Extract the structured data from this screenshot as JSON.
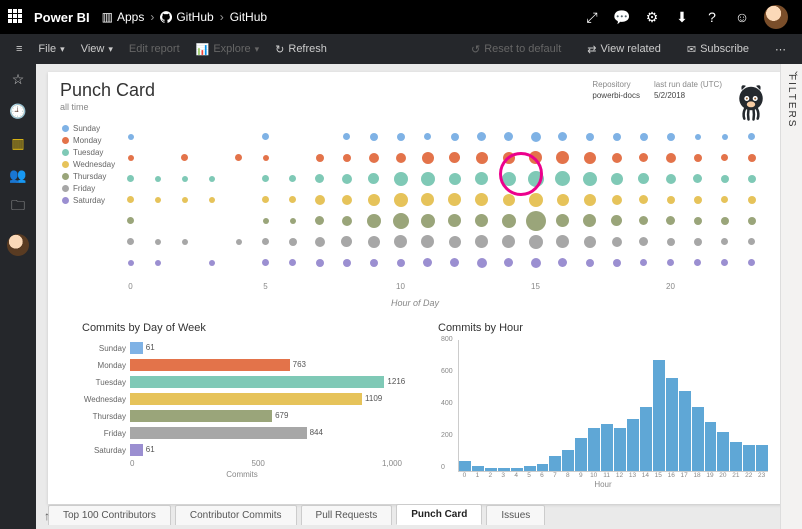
{
  "brand": "Power BI",
  "breadcrumb": {
    "apps_icon": "Apps",
    "gh_icon": "GitHub",
    "gh_page": "GitHub"
  },
  "menubar": {
    "file": "File",
    "view": "View",
    "edit": "Edit report",
    "explore": "Explore",
    "refresh": "Refresh",
    "reset": "Reset to default",
    "view_related": "View related",
    "subscribe": "Subscribe"
  },
  "filters_label": "FILTERS",
  "report": {
    "title": "Punch Card",
    "subtitle": "all time",
    "meta": {
      "repo_label": "Repository",
      "repo_value": "powerbi-docs",
      "run_label": "last run date (UTC)",
      "run_value": "5/2/2018"
    }
  },
  "days": [
    "Sunday",
    "Monday",
    "Tuesday",
    "Wednesday",
    "Thursday",
    "Friday",
    "Saturday"
  ],
  "day_colors": [
    "#7fb2e5",
    "#e3734a",
    "#7fc9b6",
    "#e6c35a",
    "#9aa57a",
    "#a7a7a7",
    "#9b8fd1"
  ],
  "punch_axis_label": "Hour of Day",
  "dow_title": "Commits by Day of Week",
  "dow_axis": "Commits",
  "hour_title": "Commits by Hour",
  "hour_axis": "Hour",
  "tabs": [
    "Top 100 Contributors",
    "Contributor Commits",
    "Pull Requests",
    "Punch Card",
    "Issues"
  ],
  "active_tab": 3,
  "chart_data": {
    "punch": {
      "type": "scatter",
      "x": [
        "0",
        "1",
        "2",
        "3",
        "4",
        "5",
        "6",
        "7",
        "8",
        "9",
        "10",
        "11",
        "12",
        "13",
        "14",
        "15",
        "16",
        "17",
        "18",
        "19",
        "20",
        "21",
        "22",
        "23"
      ],
      "days": [
        "Sunday",
        "Monday",
        "Tuesday",
        "Wednesday",
        "Thursday",
        "Friday",
        "Saturday"
      ],
      "title": "Punch Card",
      "xlabel": "Hour of Day",
      "size_matrix": [
        [
          6,
          0,
          0,
          0,
          0,
          7,
          0,
          0,
          7,
          8,
          8,
          7,
          8,
          9,
          9,
          10,
          9,
          8,
          8,
          8,
          8,
          6,
          6,
          7
        ],
        [
          6,
          0,
          7,
          0,
          7,
          6,
          0,
          8,
          8,
          10,
          10,
          12,
          11,
          12,
          12,
          13,
          13,
          12,
          10,
          9,
          10,
          8,
          7,
          8
        ],
        [
          7,
          6,
          6,
          6,
          0,
          7,
          7,
          9,
          10,
          11,
          14,
          14,
          12,
          13,
          14,
          16,
          15,
          14,
          12,
          11,
          10,
          9,
          8,
          8
        ],
        [
          7,
          6,
          6,
          6,
          0,
          7,
          7,
          10,
          10,
          12,
          14,
          13,
          13,
          13,
          12,
          14,
          12,
          12,
          10,
          9,
          8,
          8,
          7,
          8
        ],
        [
          7,
          0,
          0,
          0,
          0,
          6,
          6,
          9,
          10,
          14,
          16,
          14,
          13,
          13,
          14,
          20,
          13,
          13,
          11,
          9,
          9,
          8,
          8,
          8
        ],
        [
          7,
          6,
          6,
          0,
          6,
          7,
          8,
          10,
          11,
          12,
          13,
          13,
          12,
          13,
          13,
          14,
          13,
          12,
          10,
          9,
          8,
          8,
          7,
          7
        ],
        [
          6,
          6,
          0,
          6,
          0,
          7,
          7,
          8,
          8,
          8,
          8,
          9,
          9,
          10,
          9,
          10,
          9,
          8,
          8,
          7,
          7,
          7,
          7,
          7
        ]
      ],
      "highlight": {
        "day": "Thursday",
        "hour": 15
      }
    },
    "commits_by_day": {
      "type": "bar",
      "orientation": "horizontal",
      "title": "Commits by Day of Week",
      "categories": [
        "Sunday",
        "Monday",
        "Tuesday",
        "Wednesday",
        "Thursday",
        "Friday",
        "Saturday"
      ],
      "values": [
        61,
        763,
        1216,
        1109,
        679,
        844,
        61
      ],
      "xlabel": "Commits",
      "xlim": [
        0,
        1300
      ]
    },
    "commits_by_hour": {
      "type": "bar",
      "title": "Commits by Hour",
      "categories": [
        0,
        1,
        2,
        3,
        4,
        5,
        6,
        7,
        8,
        9,
        10,
        11,
        12,
        13,
        14,
        15,
        16,
        17,
        18,
        19,
        20,
        21,
        22,
        23
      ],
      "values": [
        60,
        30,
        20,
        20,
        20,
        30,
        40,
        90,
        130,
        200,
        260,
        290,
        260,
        320,
        390,
        680,
        570,
        490,
        390,
        300,
        240,
        180,
        160,
        160
      ],
      "xlabel": "Hour",
      "ylabel": "",
      "ylim": [
        0,
        800
      ]
    }
  }
}
